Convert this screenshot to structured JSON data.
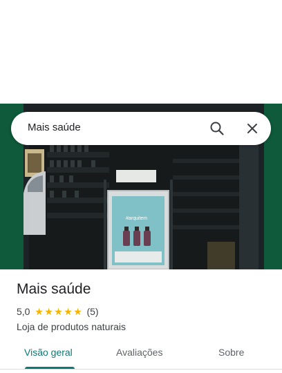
{
  "search": {
    "query": "Mais saúde",
    "search_icon": "search-icon",
    "close_icon": "close-icon"
  },
  "photo": {
    "description_icon": "storefront-photo",
    "poster_text": "#arquitem"
  },
  "place": {
    "name": "Mais saúde",
    "rating": "5,0",
    "stars": 5,
    "review_count": "(5)",
    "category": "Loja de produtos naturais"
  },
  "tabs": [
    {
      "label": "Visão geral",
      "active": true
    },
    {
      "label": "Avaliações",
      "active": false
    },
    {
      "label": "Sobre",
      "active": false
    }
  ],
  "colors": {
    "accent": "#0b7a75",
    "star": "#f4b400",
    "text": "#202124"
  }
}
